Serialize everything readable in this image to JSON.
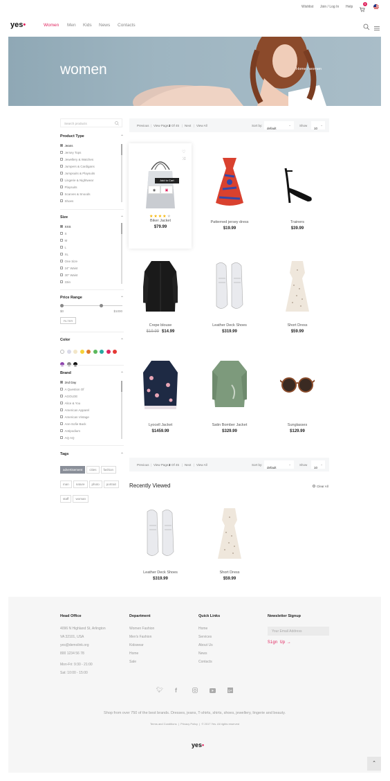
{
  "topbar": {
    "wishlist": "Wishlist",
    "login": "Join / Log In",
    "help": "Help",
    "cart_count": "0"
  },
  "brand": {
    "name": "yes",
    "accent": "#e0245e"
  },
  "nav": [
    "Women",
    "Men",
    "Kids",
    "News",
    "Contacts"
  ],
  "hero": {
    "title": "women",
    "breadcrumb_home": "Home",
    "breadcrumb_current": "women"
  },
  "search": {
    "placeholder": "Search products"
  },
  "filters": {
    "product_type": {
      "title": "Product Type",
      "items": [
        "Jeans",
        "Jersey Tops",
        "Jewellery & Watches",
        "Jumpers & Cardigans",
        "Jumpsuits & Playsuits",
        "Lingerie & Nightwear",
        "Playsuits",
        "Scarves & Snoods",
        "Shoes"
      ]
    },
    "size": {
      "title": "Size",
      "items": [
        "XXS",
        "S",
        "M",
        "L",
        "XL",
        "One Size",
        "24\" Waist",
        "30\" Waist",
        "33in"
      ]
    },
    "price": {
      "title": "Price Range",
      "min": "$0",
      "max": "$1000",
      "button": "FILTER"
    },
    "color": {
      "title": "Color",
      "swatches": [
        "#ffffff",
        "#d9d9e8",
        "#f2e6c8",
        "#f5d33a",
        "#e07a2c",
        "#5cb85c",
        "#27a9a0",
        "#e0245e",
        "#e53935",
        "#8e44ad",
        "#888888",
        "#111111"
      ]
    },
    "brand": {
      "title": "Brand",
      "items": [
        "2nd Day",
        "A Question Of",
        "AGOLDE",
        "Alice & You",
        "American Apparel",
        "American Vintage",
        "Ann-Sofie Back",
        "Antipodium",
        "AQ AQ"
      ]
    },
    "tags": {
      "title": "Tags",
      "items": [
        "advertisement",
        "cities",
        "fashion",
        "man",
        "nature",
        "photo",
        "portrait",
        "staff",
        "woman"
      ]
    }
  },
  "toolbar": {
    "previous": "Previous",
    "view_page_pre": "View Page",
    "page": "2",
    "of_text": "Of 45",
    "next": "Next",
    "view_all": "View All",
    "sort_label": "Sort by:",
    "sort_value": "default",
    "show_label": "Show",
    "show_value": "10"
  },
  "products": [
    {
      "name": "Biker Jacket",
      "price": "$79.99",
      "icon": "handbag"
    },
    {
      "name": "Patterned jersey dress",
      "price": "$19.99",
      "icon": "halter-top"
    },
    {
      "name": "Trainers",
      "price": "$39.99",
      "icon": "heel-sandal"
    },
    {
      "name": "Crepe blouse",
      "old_price": "$19.99",
      "price": "$14.99",
      "icon": "black-coat"
    },
    {
      "name": "Leather Deck Shoes",
      "price": "$319.99",
      "icon": "sneakers"
    },
    {
      "name": "Short Dress",
      "price": "$59.99",
      "icon": "lace-dress"
    },
    {
      "name": "Lyocell Jacket",
      "price": "$1459.99",
      "icon": "floral-jacket"
    },
    {
      "name": "Satin Bomber Jacket",
      "price": "$329.99",
      "icon": "green-jacket"
    },
    {
      "name": "Sunglasses",
      "price": "$129.99",
      "icon": "sunglasses"
    }
  ],
  "featured": {
    "add_to_cart": "Add to Cart",
    "rating": 4
  },
  "recent": {
    "title": "Recently Viewed",
    "clear": "Clear All",
    "items": [
      {
        "name": "Leather Deck Shoes",
        "price": "$319.99"
      },
      {
        "name": "Short Dress",
        "price": "$59.99"
      }
    ]
  },
  "footer": {
    "head_office": {
      "title": "Head Office",
      "lines": [
        "4096 N Highland St, Arlington",
        "VA 32101, USA",
        "yes@demolink.org",
        "800 1234 56 78"
      ],
      "hours": [
        "Mon-Fri:  9:30 - 21:00",
        "Sat:  10:00 - 15:00"
      ]
    },
    "department": {
      "title": "Department",
      "links": [
        "Women Fashion",
        "Men's Fashion",
        "Kidswear",
        "Home",
        "Sale"
      ]
    },
    "quick_links": {
      "title": "Quick Links",
      "links": [
        "Home",
        "Services",
        "About Us",
        "News",
        "Contacts"
      ]
    },
    "newsletter": {
      "title": "Newsletter Signup",
      "placeholder": "Your Email Address",
      "button": "Sign Up"
    },
    "tagline": "Shop from over 750 of the best brands. Dresses, jeans, T-shirts, shirts, shoes, jewellery, lingerie and beauty.",
    "legal": [
      "Terms and Conditions",
      "Privacy Policy",
      "© 2017 Yes. All rights reserved"
    ]
  }
}
